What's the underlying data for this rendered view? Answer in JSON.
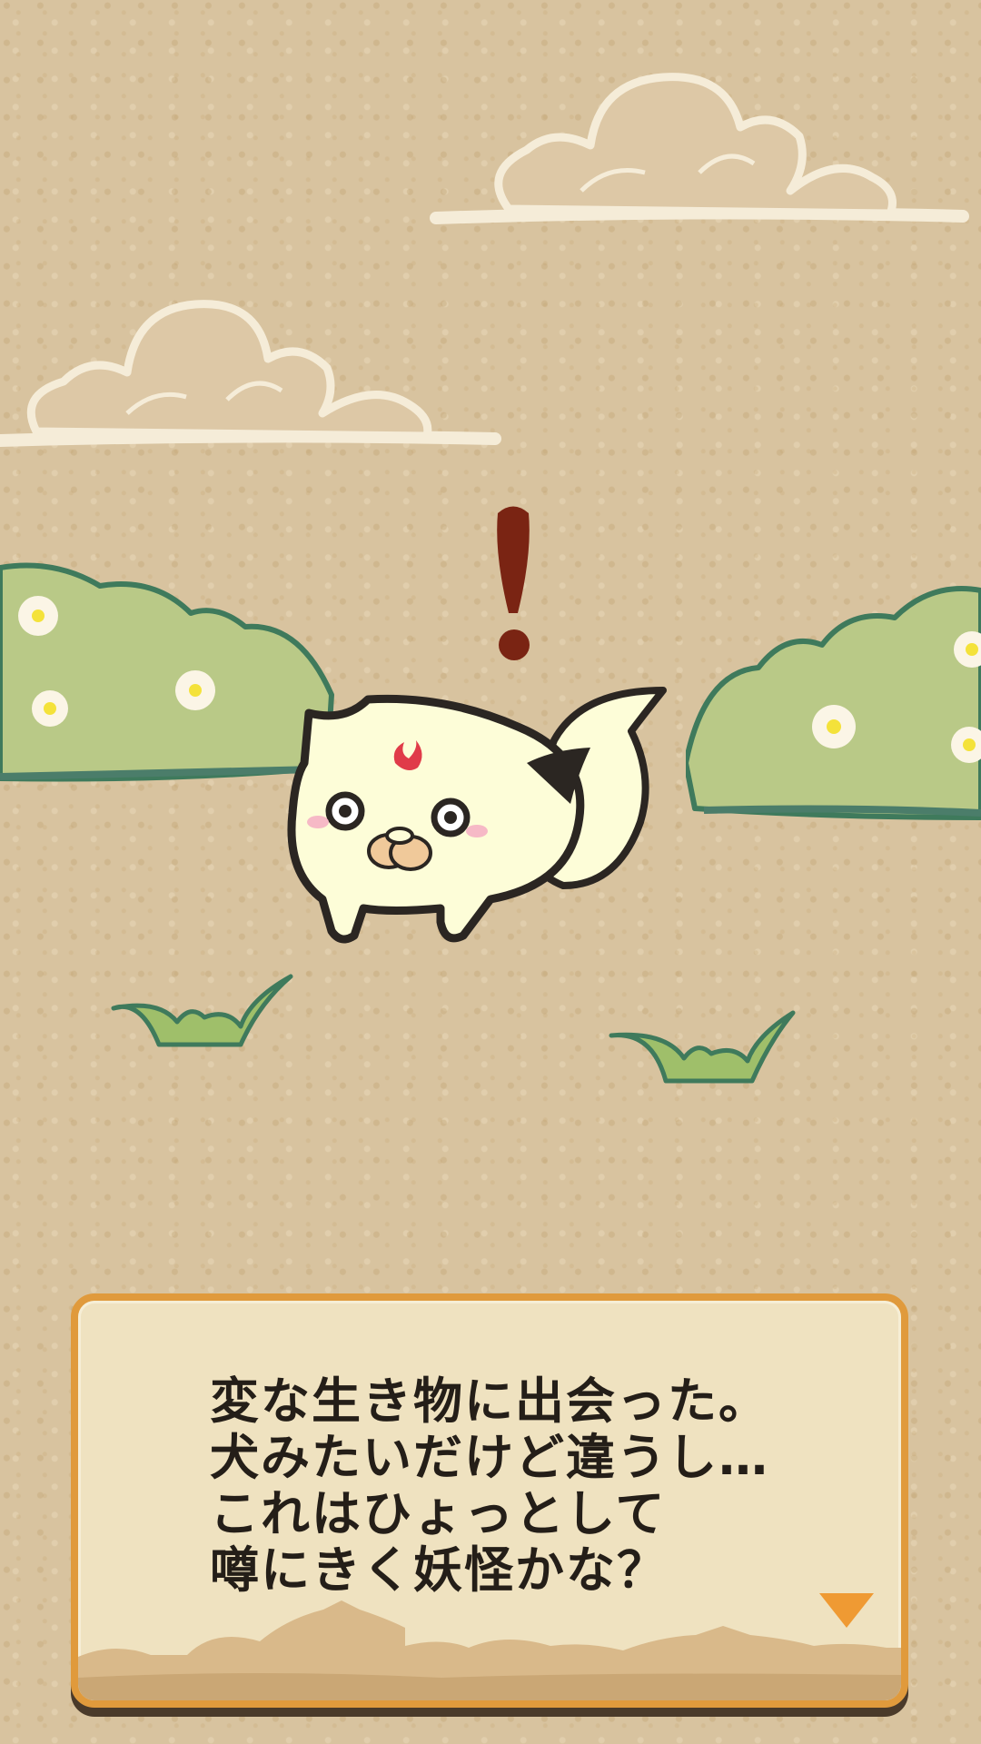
{
  "scene": {
    "background": "#d8c39f",
    "creature": "white-fox-yokai",
    "surprise_mark": "!"
  },
  "dialog": {
    "lines": [
      "変な生き物に出会った。",
      "犬みたいだけど違うし…",
      "これはひょっとして",
      "噂にきく妖怪かな？"
    ],
    "border_color": "#e09a3c",
    "next_icon": "triangle-down-icon"
  }
}
